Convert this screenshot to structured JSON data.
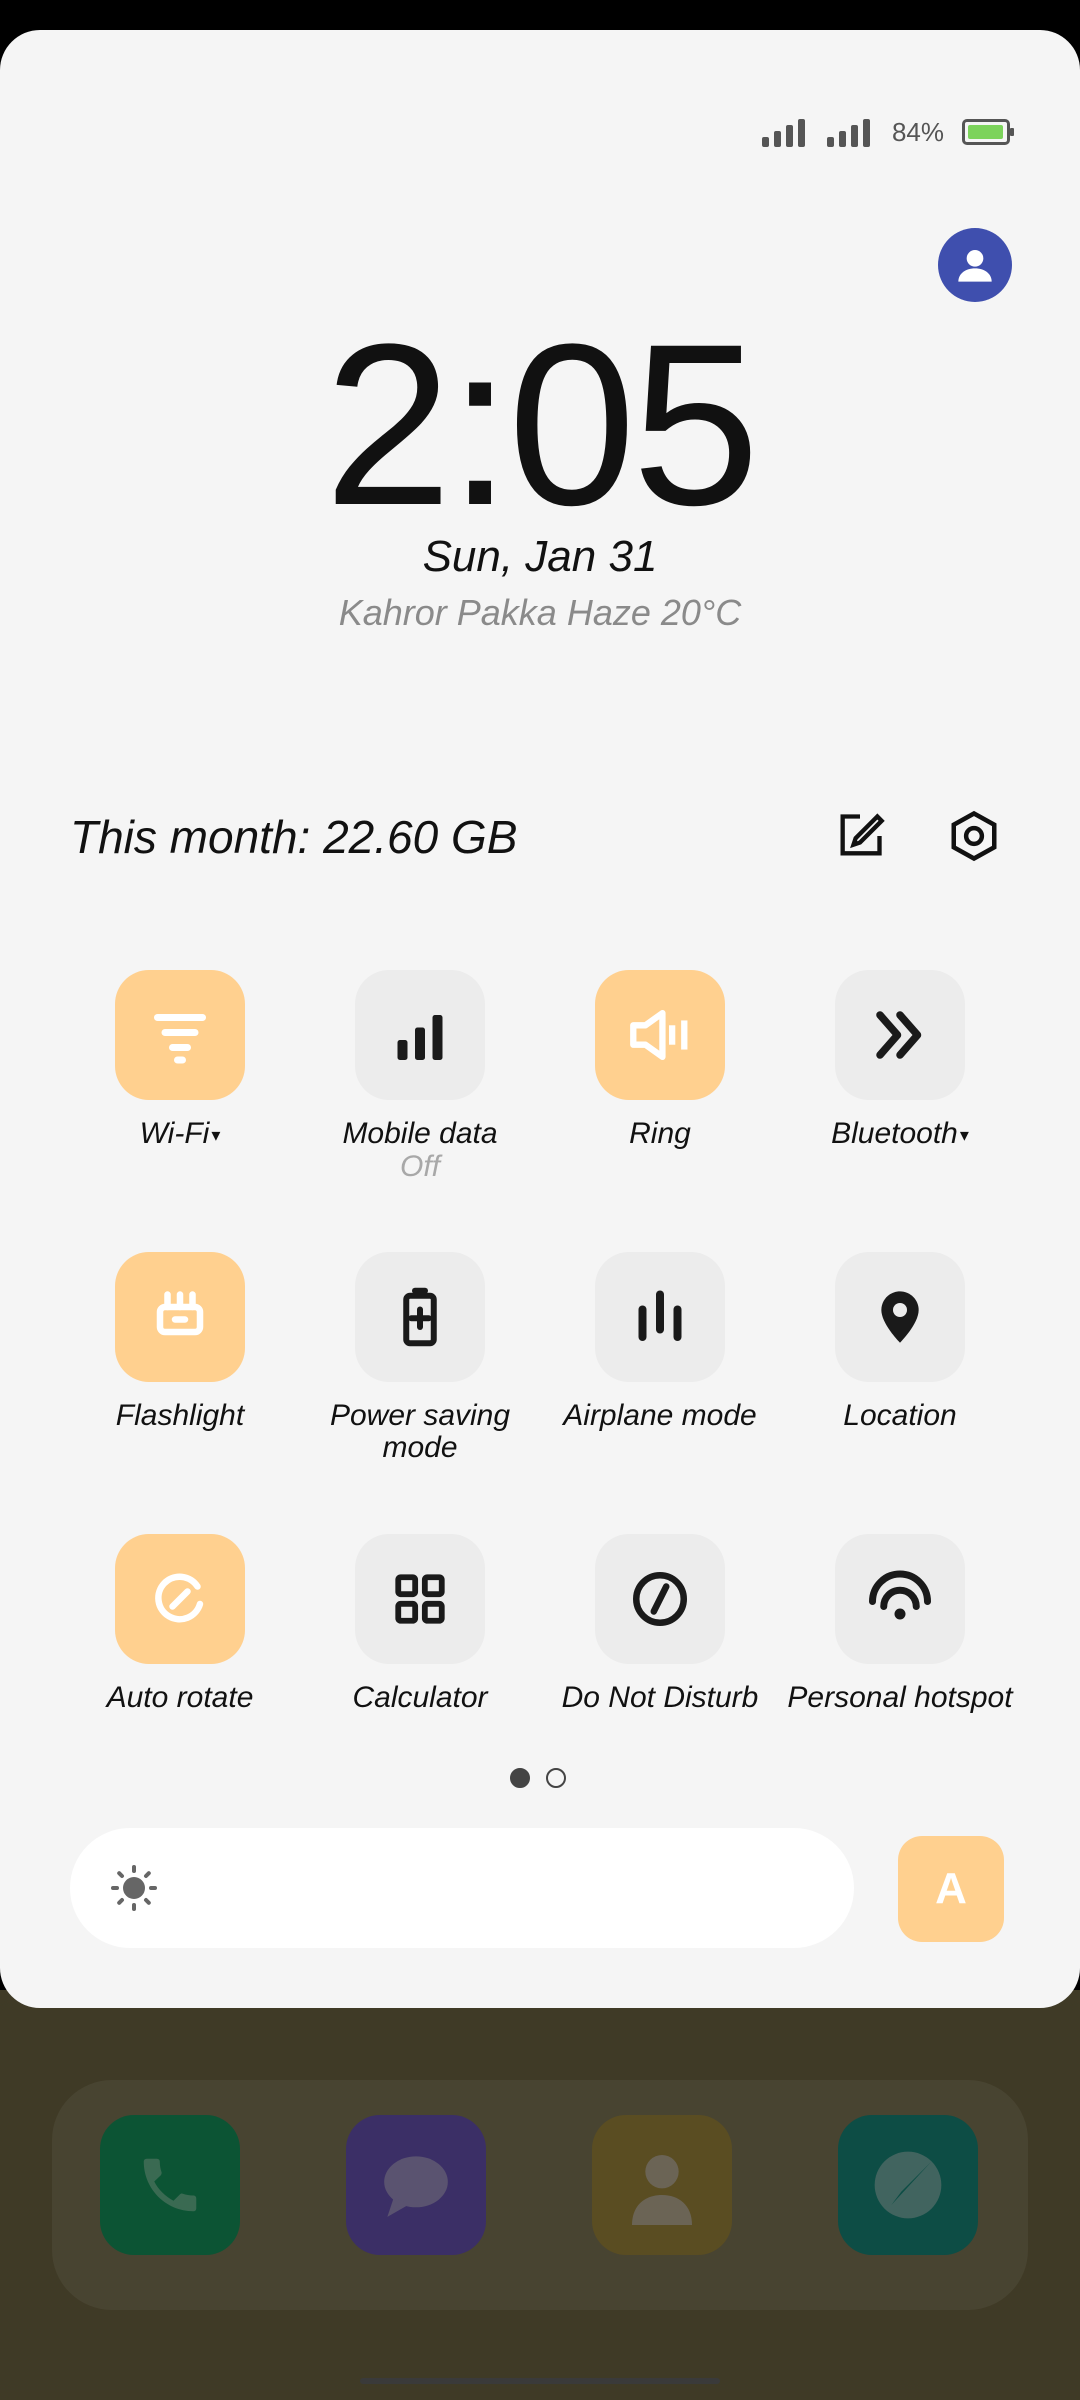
{
  "status_bar": {
    "battery_percent": "84%",
    "battery_level": 0.84,
    "signal_bars": [
      4,
      4
    ]
  },
  "lock": {
    "time": "2:05",
    "date": "Sun, Jan 31",
    "weather": "Kahror Pakka Haze 20°C"
  },
  "header": {
    "data_usage": "This month: 22.60 GB",
    "edit_icon": "edit-icon",
    "settings_icon": "settings-icon"
  },
  "tiles": [
    {
      "label": "Wi-Fi",
      "on": true,
      "caret": "▾",
      "icon": "wifi-icon"
    },
    {
      "label": "Mobile data",
      "sub": "Off",
      "on": false,
      "icon": "mobile-data-icon"
    },
    {
      "label": "Ring",
      "on": true,
      "icon": "ring-icon"
    },
    {
      "label": "Bluetooth",
      "on": false,
      "caret": "▾",
      "icon": "bluetooth-icon"
    },
    {
      "label": "Flashlight",
      "on": true,
      "icon": "flashlight-icon"
    },
    {
      "label": "Power saving mode",
      "on": false,
      "icon": "battery-icon"
    },
    {
      "label": "Airplane mode",
      "on": false,
      "icon": "airplane-icon"
    },
    {
      "label": "Location",
      "on": false,
      "icon": "location-pin-icon"
    },
    {
      "label": "Auto rotate",
      "on": true,
      "icon": "auto-rotate-icon"
    },
    {
      "label": "Calculator",
      "on": false,
      "icon": "calculator-icon"
    },
    {
      "label": "Do Not Disturb",
      "on": false,
      "icon": "dnd-icon"
    },
    {
      "label": "Personal hotspot",
      "on": false,
      "icon": "hotspot-icon"
    }
  ],
  "pager": {
    "pages": 2,
    "current": 1
  },
  "brightness": {
    "auto_label": "A"
  },
  "colors": {
    "panel": "#f5f5f5",
    "tile_on": "#ffd08f",
    "tile_off": "#ececec",
    "avatar": "#3f4fae"
  },
  "dock": [
    "phone-icon",
    "messages-icon",
    "contacts-icon",
    "browser-icon"
  ]
}
